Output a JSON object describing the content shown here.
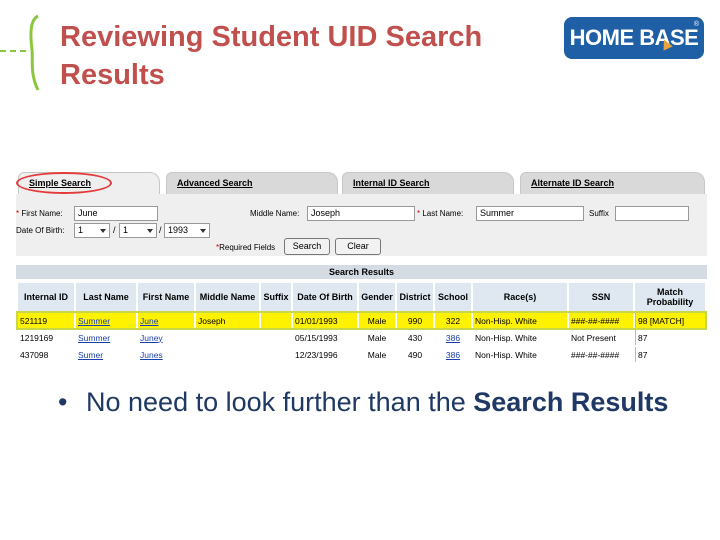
{
  "slide": {
    "title": "Reviewing Student UID Search Results",
    "bullet_dot": "•",
    "bullet_prefix": "No need to look further than the ",
    "bullet_bold": "Search Results"
  },
  "logo": {
    "text": "HOME BASE",
    "tm": "®"
  },
  "tabs": [
    "Simple Search",
    "Advanced Search",
    "Internal ID Search",
    "Alternate ID Search"
  ],
  "form": {
    "first_name_label": "First Name:",
    "first_name_value": "June",
    "middle_name_label": "Middle Name:",
    "middle_name_value": "Joseph",
    "last_name_label": "Last Name:",
    "last_name_value": "Summer",
    "suffix_label": "Suffix",
    "suffix_value": "",
    "dob_label": "Date Of Birth:",
    "dob_month": "1",
    "dob_day": "1",
    "dob_year": "1993",
    "slash": "/",
    "req_star": "*",
    "required_note": "Required Fields",
    "search_button": "Search",
    "clear_button": "Clear"
  },
  "results": {
    "heading": "Search Results",
    "columns": [
      "Internal ID",
      "Last Name",
      "First Name",
      "Middle Name",
      "Suffix",
      "Date Of Birth",
      "Gender",
      "District",
      "School",
      "Race(s)",
      "SSN",
      "Match Probability"
    ],
    "rows": [
      {
        "internal_id": "521119",
        "last_name": "Summer",
        "first_name": "June",
        "middle_name": "Joseph",
        "suffix": "",
        "dob": "01/01/1993",
        "gender": "Male",
        "district": "990",
        "school": "322",
        "race": "Non-Hisp. White",
        "ssn": "###-##-####",
        "match": "98 [MATCH]"
      },
      {
        "internal_id": "1219169",
        "last_name": "Summer",
        "first_name": "Juney",
        "middle_name": "",
        "suffix": "",
        "dob": "05/15/1993",
        "gender": "Male",
        "district": "430",
        "school": "386",
        "race": "Non-Hisp. White",
        "ssn": "Not Present",
        "match": "87"
      },
      {
        "internal_id": "437098",
        "last_name": "Sumer",
        "first_name": "Junes",
        "middle_name": "",
        "suffix": "",
        "dob": "12/23/1996",
        "gender": "Male",
        "district": "490",
        "school": "386",
        "race": "Non-Hisp. White",
        "ssn": "###-##-####",
        "match": "87"
      }
    ]
  },
  "colors": {
    "title": "#c0504d",
    "bullet": "#1f3864",
    "highlight": "#fff200",
    "logo_bg": "#1f5fa5",
    "accent_green": "#8cc63f",
    "oval_red": "#e53b3b"
  }
}
